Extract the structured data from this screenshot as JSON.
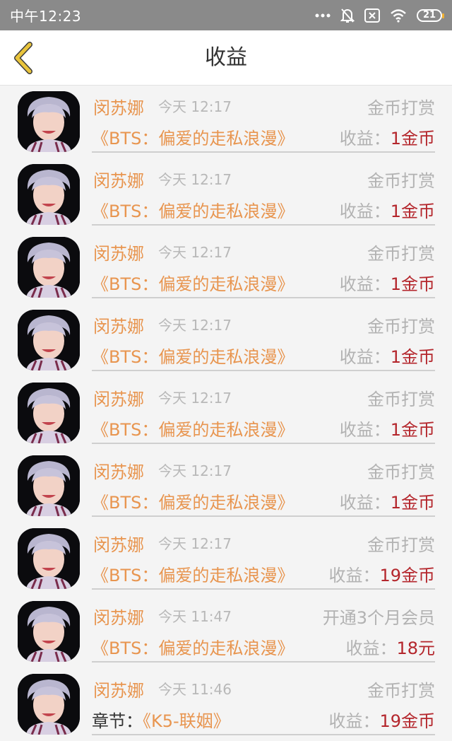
{
  "status_bar": {
    "time": "中午12:23",
    "battery": "21",
    "icons": [
      "more-dots-icon",
      "bell-muted-icon",
      "sim-x-icon",
      "wifi-icon",
      "battery-icon"
    ]
  },
  "header": {
    "title": "收益",
    "back_icon": "chevron-left-icon"
  },
  "colors": {
    "status_bar_bg": "#8a8a8a",
    "accent_orange": "#e8954f",
    "value_red": "#b4262c",
    "muted_gray": "#b2b2b2",
    "back_icon": "#e9c43c"
  },
  "income_label": "收益：",
  "records": [
    {
      "user": "闵苏娜",
      "time": "今天 12:17",
      "type": "金币打赏",
      "prefix": "",
      "book": "《BTS：偏爱的走私浪漫》",
      "amount": "1金币"
    },
    {
      "user": "闵苏娜",
      "time": "今天 12:17",
      "type": "金币打赏",
      "prefix": "",
      "book": "《BTS：偏爱的走私浪漫》",
      "amount": "1金币"
    },
    {
      "user": "闵苏娜",
      "time": "今天 12:17",
      "type": "金币打赏",
      "prefix": "",
      "book": "《BTS：偏爱的走私浪漫》",
      "amount": "1金币"
    },
    {
      "user": "闵苏娜",
      "time": "今天 12:17",
      "type": "金币打赏",
      "prefix": "",
      "book": "《BTS：偏爱的走私浪漫》",
      "amount": "1金币"
    },
    {
      "user": "闵苏娜",
      "time": "今天 12:17",
      "type": "金币打赏",
      "prefix": "",
      "book": "《BTS：偏爱的走私浪漫》",
      "amount": "1金币"
    },
    {
      "user": "闵苏娜",
      "time": "今天 12:17",
      "type": "金币打赏",
      "prefix": "",
      "book": "《BTS：偏爱的走私浪漫》",
      "amount": "1金币"
    },
    {
      "user": "闵苏娜",
      "time": "今天 12:17",
      "type": "金币打赏",
      "prefix": "",
      "book": "《BTS：偏爱的走私浪漫》",
      "amount": "19金币"
    },
    {
      "user": "闵苏娜",
      "time": "今天 11:47",
      "type": "开通3个月会员",
      "prefix": "",
      "book": "《BTS：偏爱的走私浪漫》",
      "amount": "18元"
    },
    {
      "user": "闵苏娜",
      "time": "今天 11:46",
      "type": "金币打赏",
      "prefix": "章节：",
      "book": "《K5-联姻》",
      "amount": "19金币"
    }
  ]
}
